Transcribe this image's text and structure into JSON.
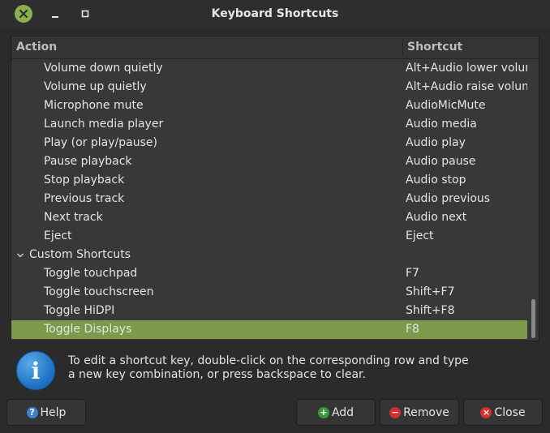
{
  "window": {
    "title": "Keyboard Shortcuts"
  },
  "columns": {
    "action": "Action",
    "shortcut": "Shortcut"
  },
  "rows": [
    {
      "action": "Volume down quietly",
      "shortcut": "Alt+Audio lower volume",
      "type": "item"
    },
    {
      "action": "Volume up quietly",
      "shortcut": "Alt+Audio raise volume",
      "type": "item"
    },
    {
      "action": "Microphone mute",
      "shortcut": "AudioMicMute",
      "type": "item"
    },
    {
      "action": "Launch media player",
      "shortcut": "Audio media",
      "type": "item"
    },
    {
      "action": "Play (or play/pause)",
      "shortcut": "Audio play",
      "type": "item"
    },
    {
      "action": "Pause playback",
      "shortcut": "Audio pause",
      "type": "item"
    },
    {
      "action": "Stop playback",
      "shortcut": "Audio stop",
      "type": "item"
    },
    {
      "action": "Previous track",
      "shortcut": "Audio previous",
      "type": "item"
    },
    {
      "action": "Next track",
      "shortcut": "Audio next",
      "type": "item"
    },
    {
      "action": "Eject",
      "shortcut": "Eject",
      "type": "item"
    },
    {
      "action": "Custom Shortcuts",
      "shortcut": "",
      "type": "group"
    },
    {
      "action": "Toggle touchpad",
      "shortcut": "F7",
      "type": "item"
    },
    {
      "action": "Toggle touchscreen",
      "shortcut": "Shift+F7",
      "type": "item"
    },
    {
      "action": "Toggle HiDPI",
      "shortcut": "Shift+F8",
      "type": "item"
    },
    {
      "action": "Toggle Displays",
      "shortcut": "F8",
      "type": "item",
      "selected": true
    }
  ],
  "info": {
    "line1": "To edit a shortcut key, double-click on the corresponding row and type",
    "line2": "a new key combination, or press backspace to clear."
  },
  "buttons": {
    "help": "Help",
    "add": "Add",
    "remove": "Remove",
    "close": "Close"
  },
  "colors": {
    "accent": "#7b9a4a",
    "window_bg": "#2b2b2b",
    "list_bg": "#383838"
  },
  "icons": {
    "close": "close-icon",
    "minimize": "minimize-icon",
    "maximize": "maximize-icon",
    "info": "info-icon",
    "help": "help-icon",
    "add": "add-icon",
    "remove": "remove-icon",
    "close_button": "close-circle-icon"
  }
}
